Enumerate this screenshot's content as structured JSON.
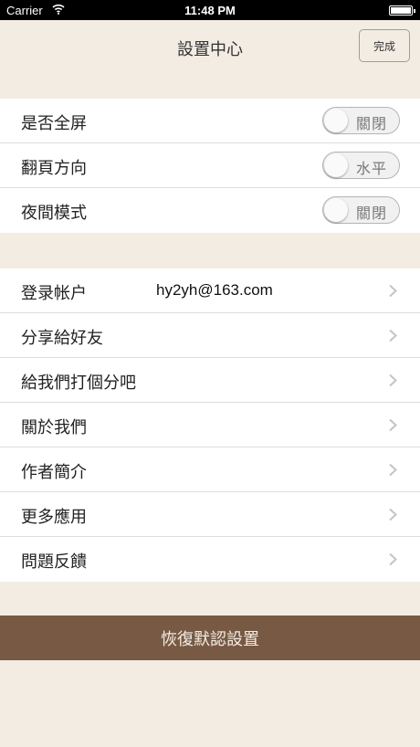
{
  "status_bar": {
    "carrier": "Carrier",
    "time": "11:48 PM",
    "wifi_icon": "wifi-icon",
    "battery_icon": "battery-icon"
  },
  "nav": {
    "title": "設置中心",
    "done_label": "完成"
  },
  "display_settings": [
    {
      "label": "是否全屏",
      "toggle_label": "關閉"
    },
    {
      "label": "翻頁方向",
      "toggle_label": "水平"
    },
    {
      "label": "夜間模式",
      "toggle_label": "關閉"
    }
  ],
  "menu": [
    {
      "label": "登录帐户",
      "value": "hy2yh@163.com"
    },
    {
      "label": "分享給好友"
    },
    {
      "label": "給我們打個分吧"
    },
    {
      "label": "關於我們"
    },
    {
      "label": "作者簡介"
    },
    {
      "label": "更多應用"
    },
    {
      "label": "問題反饋"
    }
  ],
  "reset_label": "恢復默認設置",
  "colors": {
    "background": "#f2ece3",
    "accent_button": "#785a44"
  }
}
